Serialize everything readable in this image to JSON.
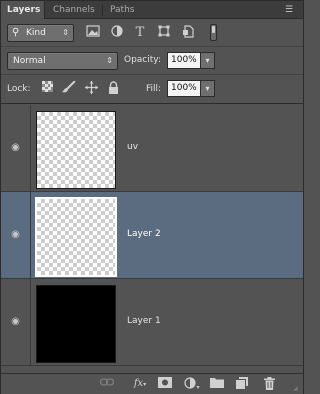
{
  "tabs": [
    {
      "label": "Layers",
      "active": true
    },
    {
      "label": "Channels",
      "active": false
    },
    {
      "label": "Paths",
      "active": false
    }
  ],
  "filter": {
    "kind_label": "Kind",
    "icons": [
      "image-filter-icon",
      "adjustment-filter-icon",
      "type-filter-icon",
      "shape-filter-icon",
      "smart-object-filter-icon"
    ]
  },
  "blend": {
    "mode": "Normal",
    "opacity_label": "Opacity:",
    "opacity_value": "100%"
  },
  "lock": {
    "label": "Lock:",
    "fill_label": "Fill:",
    "fill_value": "100%",
    "icons": [
      "lock-transparent-pixels-icon",
      "lock-image-pixels-icon",
      "lock-position-icon",
      "lock-all-icon"
    ]
  },
  "layers": [
    {
      "name": "uv",
      "thumbnail": "transparent",
      "selected": false
    },
    {
      "name": "Layer 2",
      "thumbnail": "transparent",
      "selected": true
    },
    {
      "name": "Layer 1",
      "thumbnail": "black",
      "selected": false
    }
  ],
  "bottom_icons": [
    "link-layers-icon",
    "layer-style-icon",
    "add-mask-icon",
    "adjustment-layer-icon",
    "new-group-icon",
    "new-layer-icon",
    "delete-layer-icon"
  ],
  "colors": {
    "panel_bg": "#535353",
    "selected_layer_bg": "#5b6b80"
  }
}
